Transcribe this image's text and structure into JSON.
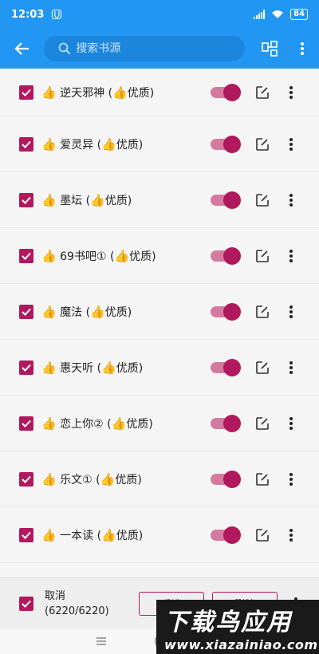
{
  "status_bar": {
    "time": "12:03",
    "battery": "84"
  },
  "app_bar": {
    "search_placeholder": "搜索书源"
  },
  "sources": [
    {
      "name": "逆天邪神",
      "tag": "优质",
      "enabled": true,
      "checked": true
    },
    {
      "name": "爱灵异",
      "tag": "优质",
      "enabled": true,
      "checked": true
    },
    {
      "name": "墨坛",
      "tag": "优质",
      "enabled": true,
      "checked": true
    },
    {
      "name": "69书吧①",
      "tag": "优质",
      "enabled": true,
      "checked": true
    },
    {
      "name": "魔法",
      "tag": "优质",
      "enabled": true,
      "checked": true
    },
    {
      "name": "惠天听",
      "tag": "优质",
      "enabled": true,
      "checked": true
    },
    {
      "name": "恋上你②",
      "tag": "优质",
      "enabled": true,
      "checked": true
    },
    {
      "name": "乐文①",
      "tag": "优质",
      "enabled": true,
      "checked": true
    },
    {
      "name": "一本读",
      "tag": "优质",
      "enabled": true,
      "checked": true
    }
  ],
  "bottom_bar": {
    "cancel_label": "取消",
    "count": "(6220/6220)",
    "invert_label": "反选",
    "delete_label": "删除"
  },
  "watermark": {
    "line1": "下载鸟应用",
    "line2": "www.xiazainiao.com"
  },
  "colors": {
    "primary": "#2196f3",
    "accent": "#b0195e",
    "switch_track": "#d47aa0"
  },
  "icons": [
    "back-arrow-icon",
    "search-icon",
    "qr-scan-icon",
    "more-vert-icon",
    "edit-icon",
    "checkbox-icon",
    "thumbs-up-icon"
  ]
}
